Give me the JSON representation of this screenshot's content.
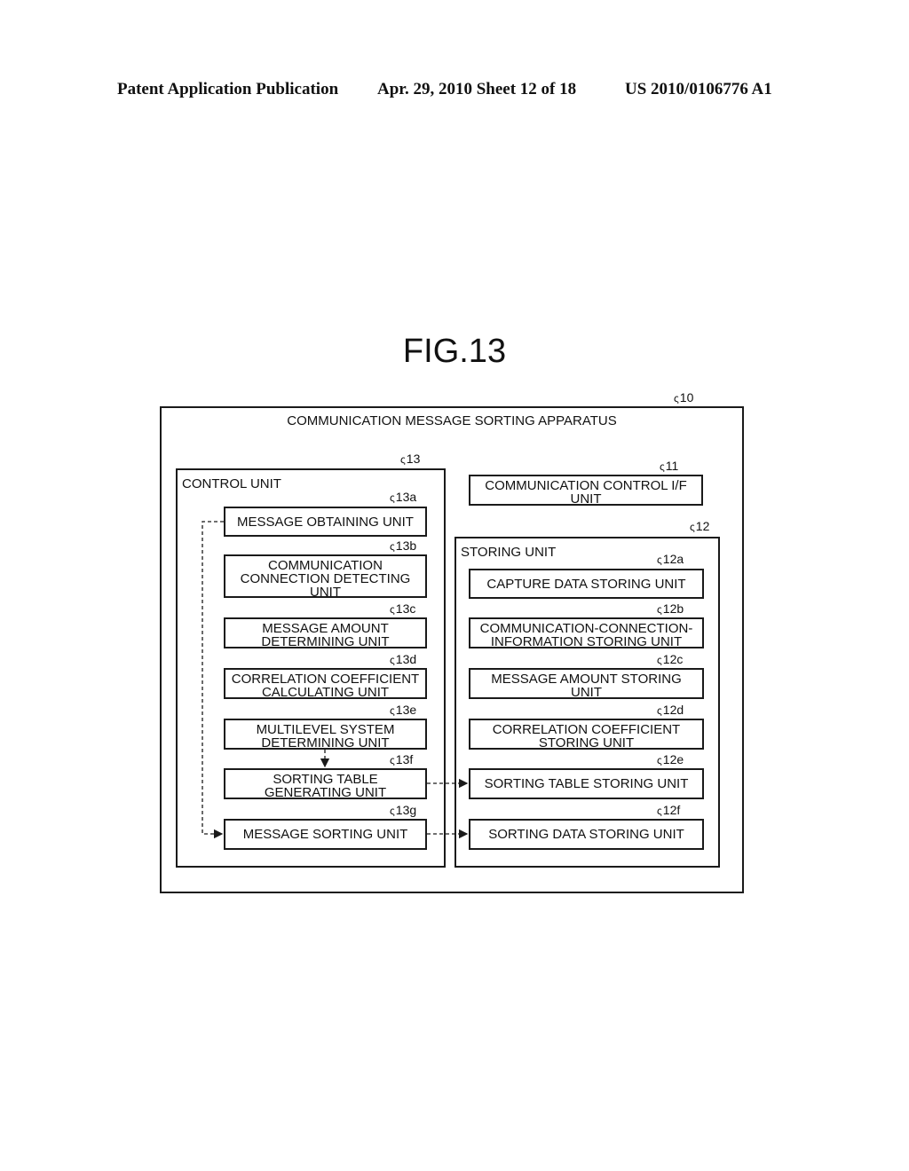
{
  "header": {
    "publication": "Patent Application Publication",
    "date_sheet": "Apr. 29, 2010  Sheet 12 of 18",
    "patent_number": "US 2010/0106776 A1"
  },
  "figure": {
    "title": "FIG.13",
    "apparatus": {
      "ref": "10",
      "label": "COMMUNICATION MESSAGE SORTING APPARATUS"
    },
    "control_unit": {
      "ref": "13",
      "label": "CONTROL UNIT",
      "units": [
        {
          "ref": "13a",
          "label": "MESSAGE OBTAINING UNIT"
        },
        {
          "ref": "13b",
          "label": "COMMUNICATION CONNECTION DETECTING UNIT"
        },
        {
          "ref": "13c",
          "label": "MESSAGE AMOUNT DETERMINING UNIT"
        },
        {
          "ref": "13d",
          "label": "CORRELATION COEFFICIENT CALCULATING UNIT"
        },
        {
          "ref": "13e",
          "label": "MULTILEVEL SYSTEM DETERMINING UNIT"
        },
        {
          "ref": "13f",
          "label": "SORTING TABLE GENERATING UNIT"
        },
        {
          "ref": "13g",
          "label": "MESSAGE SORTING UNIT"
        }
      ]
    },
    "comm_if_unit": {
      "ref": "11",
      "label": "COMMUNICATION CONTROL I/F UNIT"
    },
    "storing_unit": {
      "ref": "12",
      "label": "STORING UNIT",
      "units": [
        {
          "ref": "12a",
          "label": "CAPTURE DATA STORING UNIT"
        },
        {
          "ref": "12b",
          "label": "COMMUNICATION-CONNECTION-INFORMATION STORING UNIT"
        },
        {
          "ref": "12c",
          "label": "MESSAGE AMOUNT STORING UNIT"
        },
        {
          "ref": "12d",
          "label": "CORRELATION COEFFICIENT STORING UNIT"
        },
        {
          "ref": "12e",
          "label": "SORTING TABLE STORING UNIT"
        },
        {
          "ref": "12f",
          "label": "SORTING DATA STORING UNIT"
        }
      ]
    }
  }
}
